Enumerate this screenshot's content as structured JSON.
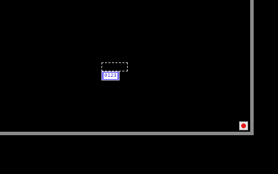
{
  "canvas": {
    "counter_label": "0123"
  },
  "icons": {
    "record": "record-icon"
  },
  "colors": {
    "background": "#000000",
    "frame": "#8a8a8a",
    "badge": "#5e50ff",
    "record": "#e01818"
  }
}
